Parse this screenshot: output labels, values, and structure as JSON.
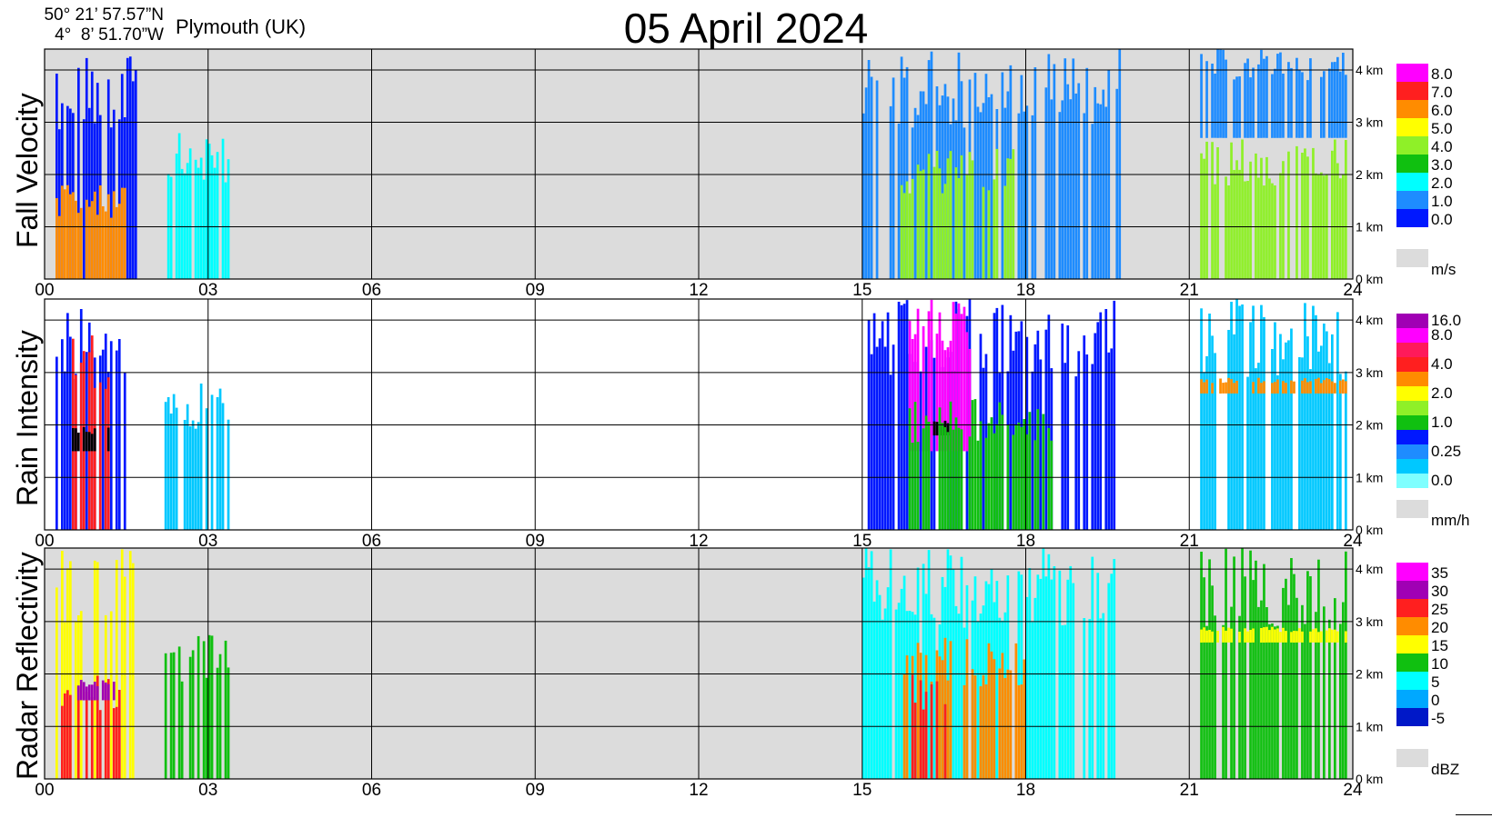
{
  "header": {
    "lat": "50° 21’ 57.57”N",
    "lon": "4°  8’ 51.70”W",
    "site": "Plymouth (UK)",
    "title": "05 April 2024"
  },
  "colors": {
    "no_data_background": "#dcdcdc",
    "grid": "#000000"
  },
  "chart_data": [
    {
      "type": "heatmap",
      "ylabel": "Fall Velocity",
      "x_ticks": [
        "00",
        "03",
        "06",
        "09",
        "12",
        "15",
        "18",
        "21",
        "24"
      ],
      "y_ticks": [
        "0 km",
        "1 km",
        "2 km",
        "3 km",
        "4 km"
      ],
      "xlim": [
        0,
        24
      ],
      "ylim_km": [
        0,
        4.4
      ],
      "background": "#dcdcdc",
      "colorbar": {
        "unit": "m/s",
        "levels": [
          {
            "label": "8.0",
            "color": "#ff00ff"
          },
          {
            "label": "7.0",
            "color": "#ff1f1f"
          },
          {
            "label": "6.0",
            "color": "#ff8c00"
          },
          {
            "label": "5.0",
            "color": "#ffff00"
          },
          {
            "label": "4.0",
            "color": "#8ff028"
          },
          {
            "label": "3.0",
            "color": "#10c010"
          },
          {
            "label": "2.0",
            "color": "#00ffff"
          },
          {
            "label": "1.0",
            "color": "#1e8cff"
          },
          {
            "label": "0.0",
            "color": "#0018ff"
          }
        ],
        "no_data_color": "#dcdcdc"
      },
      "echo_regions": [
        {
          "t0": 0.2,
          "t1": 1.7,
          "h0": 0,
          "h1": 4.4,
          "color": "#0018ff"
        },
        {
          "t0": 0.2,
          "t1": 1.5,
          "h0": 0,
          "h1": 1.8,
          "color": "#ff8c00"
        },
        {
          "t0": 2.2,
          "t1": 3.4,
          "h0": 0,
          "h1": 2.8,
          "color": "#00ffff"
        },
        {
          "t0": 15.0,
          "t1": 19.8,
          "h0": 0,
          "h1": 4.4,
          "color": "#1e8cff"
        },
        {
          "t0": 15.7,
          "t1": 17.8,
          "h0": 0,
          "h1": 2.5,
          "color": "#8ff028"
        },
        {
          "t0": 21.2,
          "t1": 23.9,
          "h0": 0,
          "h1": 2.7,
          "color": "#8ff028"
        },
        {
          "t0": 21.2,
          "t1": 23.9,
          "h0": 2.7,
          "h1": 4.4,
          "color": "#1e8cff"
        }
      ]
    },
    {
      "type": "heatmap",
      "ylabel": "Rain Intensity",
      "x_ticks": [
        "00",
        "03",
        "06",
        "09",
        "12",
        "15",
        "18",
        "21",
        "24"
      ],
      "y_ticks": [
        "0 km",
        "1 km",
        "2 km",
        "3 km",
        "4 km"
      ],
      "xlim": [
        0,
        24
      ],
      "ylim_km": [
        0,
        4.4
      ],
      "background": "#ffffff",
      "colorbar": {
        "unit": "mm/h",
        "levels": [
          {
            "label": "16.0",
            "color": "#a000b4"
          },
          {
            "label": "8.0",
            "color": "#ff00ff"
          },
          {
            "label": "",
            "color": "#ff1a5a"
          },
          {
            "label": "4.0",
            "color": "#ff1f1f"
          },
          {
            "label": "",
            "color": "#ff8c00"
          },
          {
            "label": "2.0",
            "color": "#ffff00"
          },
          {
            "label": "",
            "color": "#8ff028"
          },
          {
            "label": "1.0",
            "color": "#10c010"
          },
          {
            "label": "",
            "color": "#0018ff"
          },
          {
            "label": "0.25",
            "color": "#1e8cff"
          },
          {
            "label": "",
            "color": "#00c8ff"
          },
          {
            "label": "0.0",
            "color": "#7fffff"
          }
        ],
        "no_data_color": "#dcdcdc"
      },
      "echo_regions": [
        {
          "t0": 0.2,
          "t1": 1.5,
          "h0": 0,
          "h1": 4.4,
          "color": "#0018ff"
        },
        {
          "t0": 0.5,
          "t1": 1.2,
          "h0": 0,
          "h1": 4.0,
          "color": "#ff1f1f"
        },
        {
          "t0": 0.5,
          "t1": 1.2,
          "h0": 1.5,
          "h1": 2.0,
          "color": "#000000"
        },
        {
          "t0": 2.2,
          "t1": 3.4,
          "h0": 0,
          "h1": 2.8,
          "color": "#00c8ff"
        },
        {
          "t0": 15.0,
          "t1": 19.8,
          "h0": 0,
          "h1": 4.4,
          "color": "#0018ff"
        },
        {
          "t0": 15.8,
          "t1": 17.0,
          "h0": 1.5,
          "h1": 4.4,
          "color": "#ff00ff"
        },
        {
          "t0": 16.3,
          "t1": 16.6,
          "h0": 1.8,
          "h1": 2.1,
          "color": "#000000"
        },
        {
          "t0": 15.8,
          "t1": 18.5,
          "h0": 0,
          "h1": 2.5,
          "color": "#10c010"
        },
        {
          "t0": 21.2,
          "t1": 23.9,
          "h0": 0,
          "h1": 4.4,
          "color": "#00c8ff"
        },
        {
          "t0": 21.2,
          "t1": 23.9,
          "h0": 2.6,
          "h1": 2.9,
          "color": "#ff8c00"
        }
      ]
    },
    {
      "type": "heatmap",
      "ylabel": "Radar Reflectivity",
      "x_ticks": [
        "00",
        "03",
        "06",
        "09",
        "12",
        "15",
        "18",
        "21",
        "24"
      ],
      "y_ticks": [
        "0 km",
        "1 km",
        "2 km",
        "3 km",
        "4 km"
      ],
      "xlim": [
        0,
        24
      ],
      "ylim_km": [
        0,
        4.4
      ],
      "background": "#dcdcdc",
      "colorbar": {
        "unit": "dBZ",
        "levels": [
          {
            "label": "35",
            "color": "#ff00ff"
          },
          {
            "label": "30",
            "color": "#a000b4"
          },
          {
            "label": "25",
            "color": "#ff1f1f"
          },
          {
            "label": "20",
            "color": "#ff8c00"
          },
          {
            "label": "15",
            "color": "#ffff00"
          },
          {
            "label": "10",
            "color": "#10c010"
          },
          {
            "label": "5",
            "color": "#00ffff"
          },
          {
            "label": "0",
            "color": "#00a8ff"
          },
          {
            "label": "-5",
            "color": "#0018c8"
          }
        ],
        "no_data_color": "#dcdcdc"
      },
      "echo_regions": [
        {
          "t0": 0.2,
          "t1": 1.7,
          "h0": 0,
          "h1": 4.4,
          "color": "#ffff00"
        },
        {
          "t0": 0.3,
          "t1": 1.5,
          "h0": 0,
          "h1": 2.0,
          "color": "#ff1f1f"
        },
        {
          "t0": 0.6,
          "t1": 1.3,
          "h0": 1.5,
          "h1": 1.9,
          "color": "#a000b4"
        },
        {
          "t0": 2.2,
          "t1": 3.4,
          "h0": 0,
          "h1": 2.8,
          "color": "#10c010"
        },
        {
          "t0": 15.0,
          "t1": 19.8,
          "h0": 0,
          "h1": 4.4,
          "color": "#00ffff"
        },
        {
          "t0": 15.7,
          "t1": 18.0,
          "h0": 0,
          "h1": 2.7,
          "color": "#ff8c00"
        },
        {
          "t0": 15.9,
          "t1": 16.6,
          "h0": 0,
          "h1": 2.0,
          "color": "#ff1f1f"
        },
        {
          "t0": 21.2,
          "t1": 23.9,
          "h0": 0,
          "h1": 4.4,
          "color": "#10c010"
        },
        {
          "t0": 21.2,
          "t1": 23.9,
          "h0": 2.6,
          "h1": 2.9,
          "color": "#ffff00"
        }
      ]
    }
  ]
}
